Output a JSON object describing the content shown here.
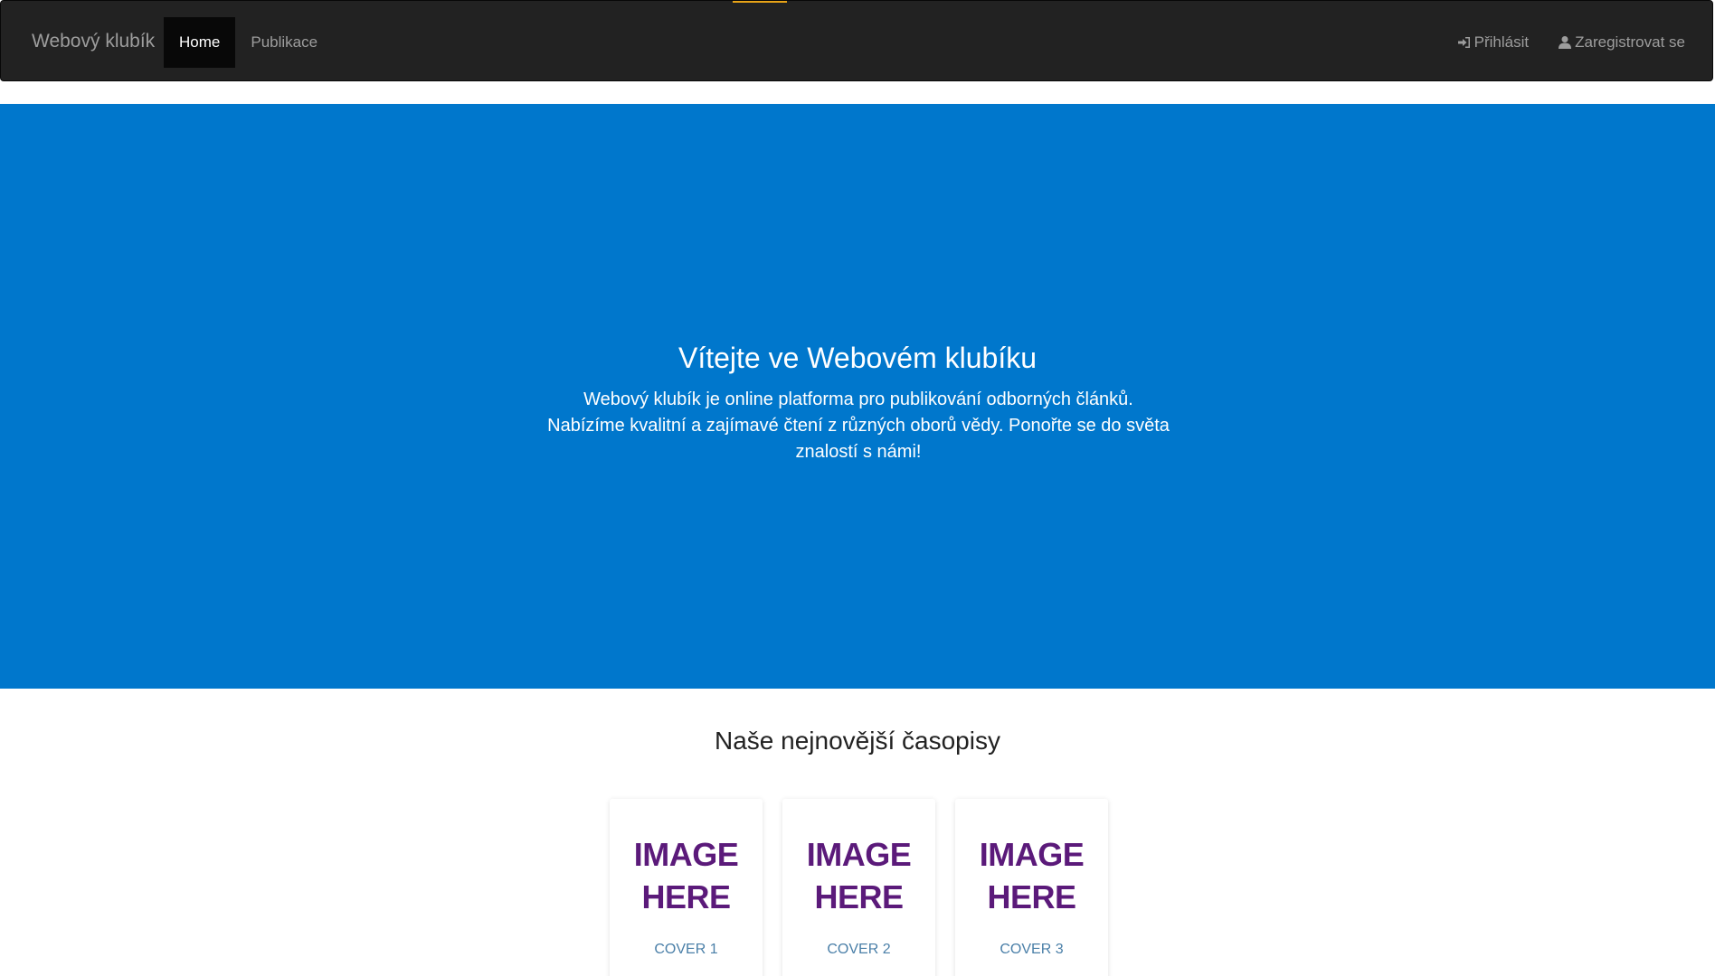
{
  "colors": {
    "navbar_bg": "#222222",
    "navbar_text": "#9d9d9d",
    "navbar_active_bg": "#080808",
    "accent": "#e8a317",
    "hero_bg": "#0077cc",
    "cover_image_text": "#5b1a7a",
    "cover_label": "#4a7fa8"
  },
  "navbar": {
    "brand": "Webový klubík",
    "left_items": [
      {
        "label": "Home",
        "active": true
      },
      {
        "label": "Publikace",
        "active": false
      }
    ],
    "right_items": [
      {
        "label": "Přihlásit",
        "icon": "log-in-icon"
      },
      {
        "label": "Zaregistrovat se",
        "icon": "user-icon"
      }
    ]
  },
  "hero": {
    "title": "Vítejte ve Webovém klubíku",
    "text": "Webový klubík je online platforma pro publikování odborných článků. Nabízíme kvalitní a zajímavé čtení z různých oborů vědy. Ponořte se do světa znalostí s námi!"
  },
  "section": {
    "title": "Naše nejnovější časopisy",
    "covers": [
      {
        "image_line1": "IMAGE",
        "image_line2": "HERE",
        "label": "COVER 1"
      },
      {
        "image_line1": "IMAGE",
        "image_line2": "HERE",
        "label": "COVER 2"
      },
      {
        "image_line1": "IMAGE",
        "image_line2": "HERE",
        "label": "COVER 3"
      }
    ]
  }
}
